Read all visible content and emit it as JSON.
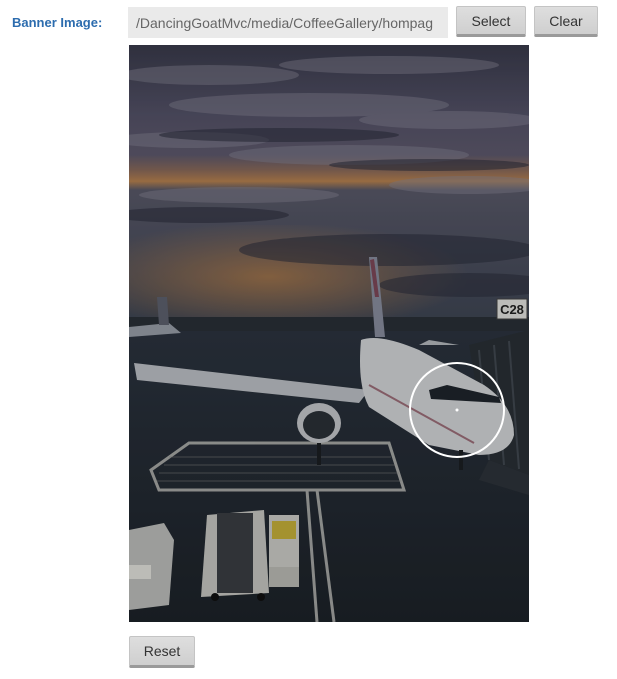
{
  "field": {
    "label": "Banner Image:",
    "path_value": "/DancingGoatMvc/media/CoffeeGallery/hompag"
  },
  "buttons": {
    "select_label": "Select",
    "clear_label": "Clear",
    "reset_label": "Reset"
  },
  "image": {
    "gate_sign": "C28",
    "subject": "airplane at airport gate at dusk"
  },
  "colors": {
    "label": "#2c6cae",
    "input_bg": "#eaeaea",
    "button_bg": "#d6d6d6"
  }
}
